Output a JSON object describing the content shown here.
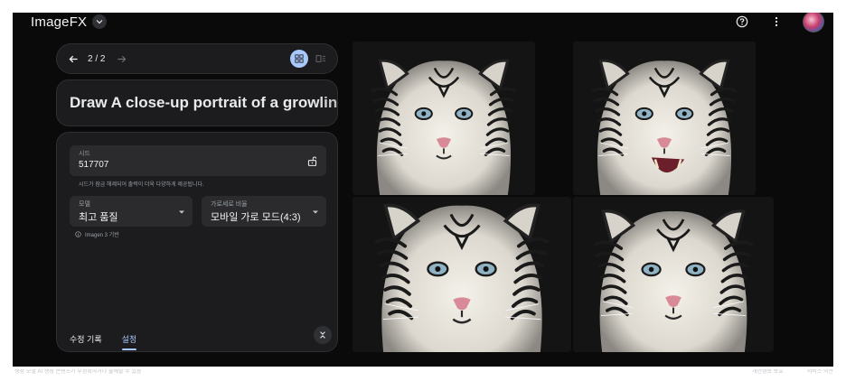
{
  "header": {
    "app_name": "ImageFX",
    "icons": [
      "help-icon",
      "more-vert-icon",
      "account-avatar"
    ]
  },
  "navigation": {
    "counter": "2 / 2",
    "view_modes": [
      "grid-view-icon",
      "list-view-icon"
    ],
    "active_view": "grid"
  },
  "prompt": {
    "text": "Draw A close-up portrait of a growling white tiger"
  },
  "settings": {
    "seed": {
      "label": "시드",
      "value": "517707",
      "help": "시드가 잠금 해제되어 출력이 더욱 다양하게 제공됩니다."
    },
    "model": {
      "label": "모델",
      "value": "최고 품질",
      "note": "Imagen 3 기반"
    },
    "aspect_ratio": {
      "label": "가로세로 비율",
      "value": "모바일 가로 모드(4:3)"
    }
  },
  "tabs": [
    {
      "label": "수정 기록",
      "active": false
    },
    {
      "label": "설정",
      "active": true
    }
  ],
  "images": [
    {
      "name": "white-tiger-front",
      "pose": "front"
    },
    {
      "name": "white-tiger-roaring",
      "pose": "roar"
    },
    {
      "name": "white-tiger-front-2",
      "pose": "front"
    },
    {
      "name": "white-tiger-front-3",
      "pose": "front"
    }
  ],
  "footer": {
    "left": "생성 모델 AI 생성 콘텐츠가 부정확하거나 불쾌할 수 있음",
    "right": [
      "개인정보 보호",
      "서비스 약관"
    ]
  },
  "colors": {
    "background": "#0a0a0a",
    "card": "#1c1c1e",
    "field": "#2b2b2d",
    "accent": "#a8c7fa",
    "text": "#e8eaed",
    "muted": "#9aa0a6"
  }
}
